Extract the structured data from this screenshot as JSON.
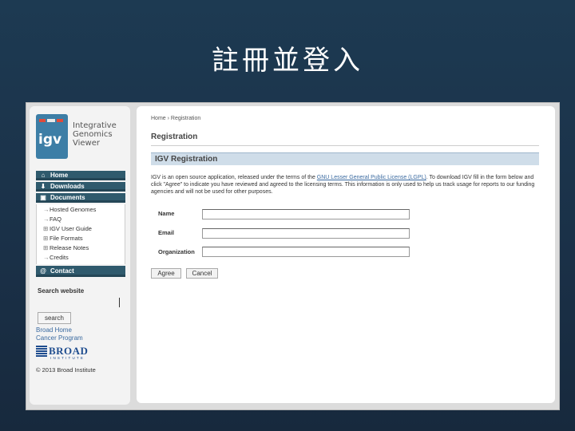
{
  "slide": {
    "title": "註冊並登入"
  },
  "sidebar": {
    "logo": {
      "word": "igv",
      "lines": [
        "Integrative",
        "Genomics",
        "Viewer"
      ]
    },
    "nav": [
      {
        "label": "Home",
        "icon": "home-icon"
      },
      {
        "label": "Downloads",
        "icon": "download-icon"
      },
      {
        "label": "Documents",
        "icon": "document-icon"
      }
    ],
    "sub_items": [
      {
        "mark": "→",
        "label": "Hosted Genomes"
      },
      {
        "mark": "→",
        "label": "FAQ"
      },
      {
        "mark": "⊞",
        "label": "IGV User Guide"
      },
      {
        "mark": "⊞",
        "label": "File Formats"
      },
      {
        "mark": "⊞",
        "label": "Release Notes"
      },
      {
        "mark": "→",
        "label": "Credits"
      }
    ],
    "contact": {
      "label": "Contact",
      "icon": "at-icon"
    },
    "search": {
      "label": "Search website",
      "value": "",
      "button": "search"
    },
    "links": [
      "Broad Home",
      "Cancer Program"
    ],
    "broad": {
      "name": "BROAD",
      "sub": "INSTITUTE"
    },
    "copyright": "© 2013 Broad Institute"
  },
  "main": {
    "breadcrumb": "Home › Registration",
    "title": "Registration",
    "section": "IGV Registration",
    "intro": {
      "before": "IGV is an open source application, released under the terms of the ",
      "link": "GNU Lesser General Public License (LGPL)",
      "after": ". To download IGV fill in the form below and click \"Agree\" to indicate you have reviewed and agreed to the licensing terms. This information is only used to help us track usage for reports to our funding agencies and will not be used for other purposes."
    },
    "fields": [
      {
        "label": "Name",
        "value": ""
      },
      {
        "label": "Email",
        "value": ""
      },
      {
        "label": "Organization",
        "value": ""
      }
    ],
    "buttons": {
      "agree": "Agree",
      "cancel": "Cancel"
    }
  }
}
